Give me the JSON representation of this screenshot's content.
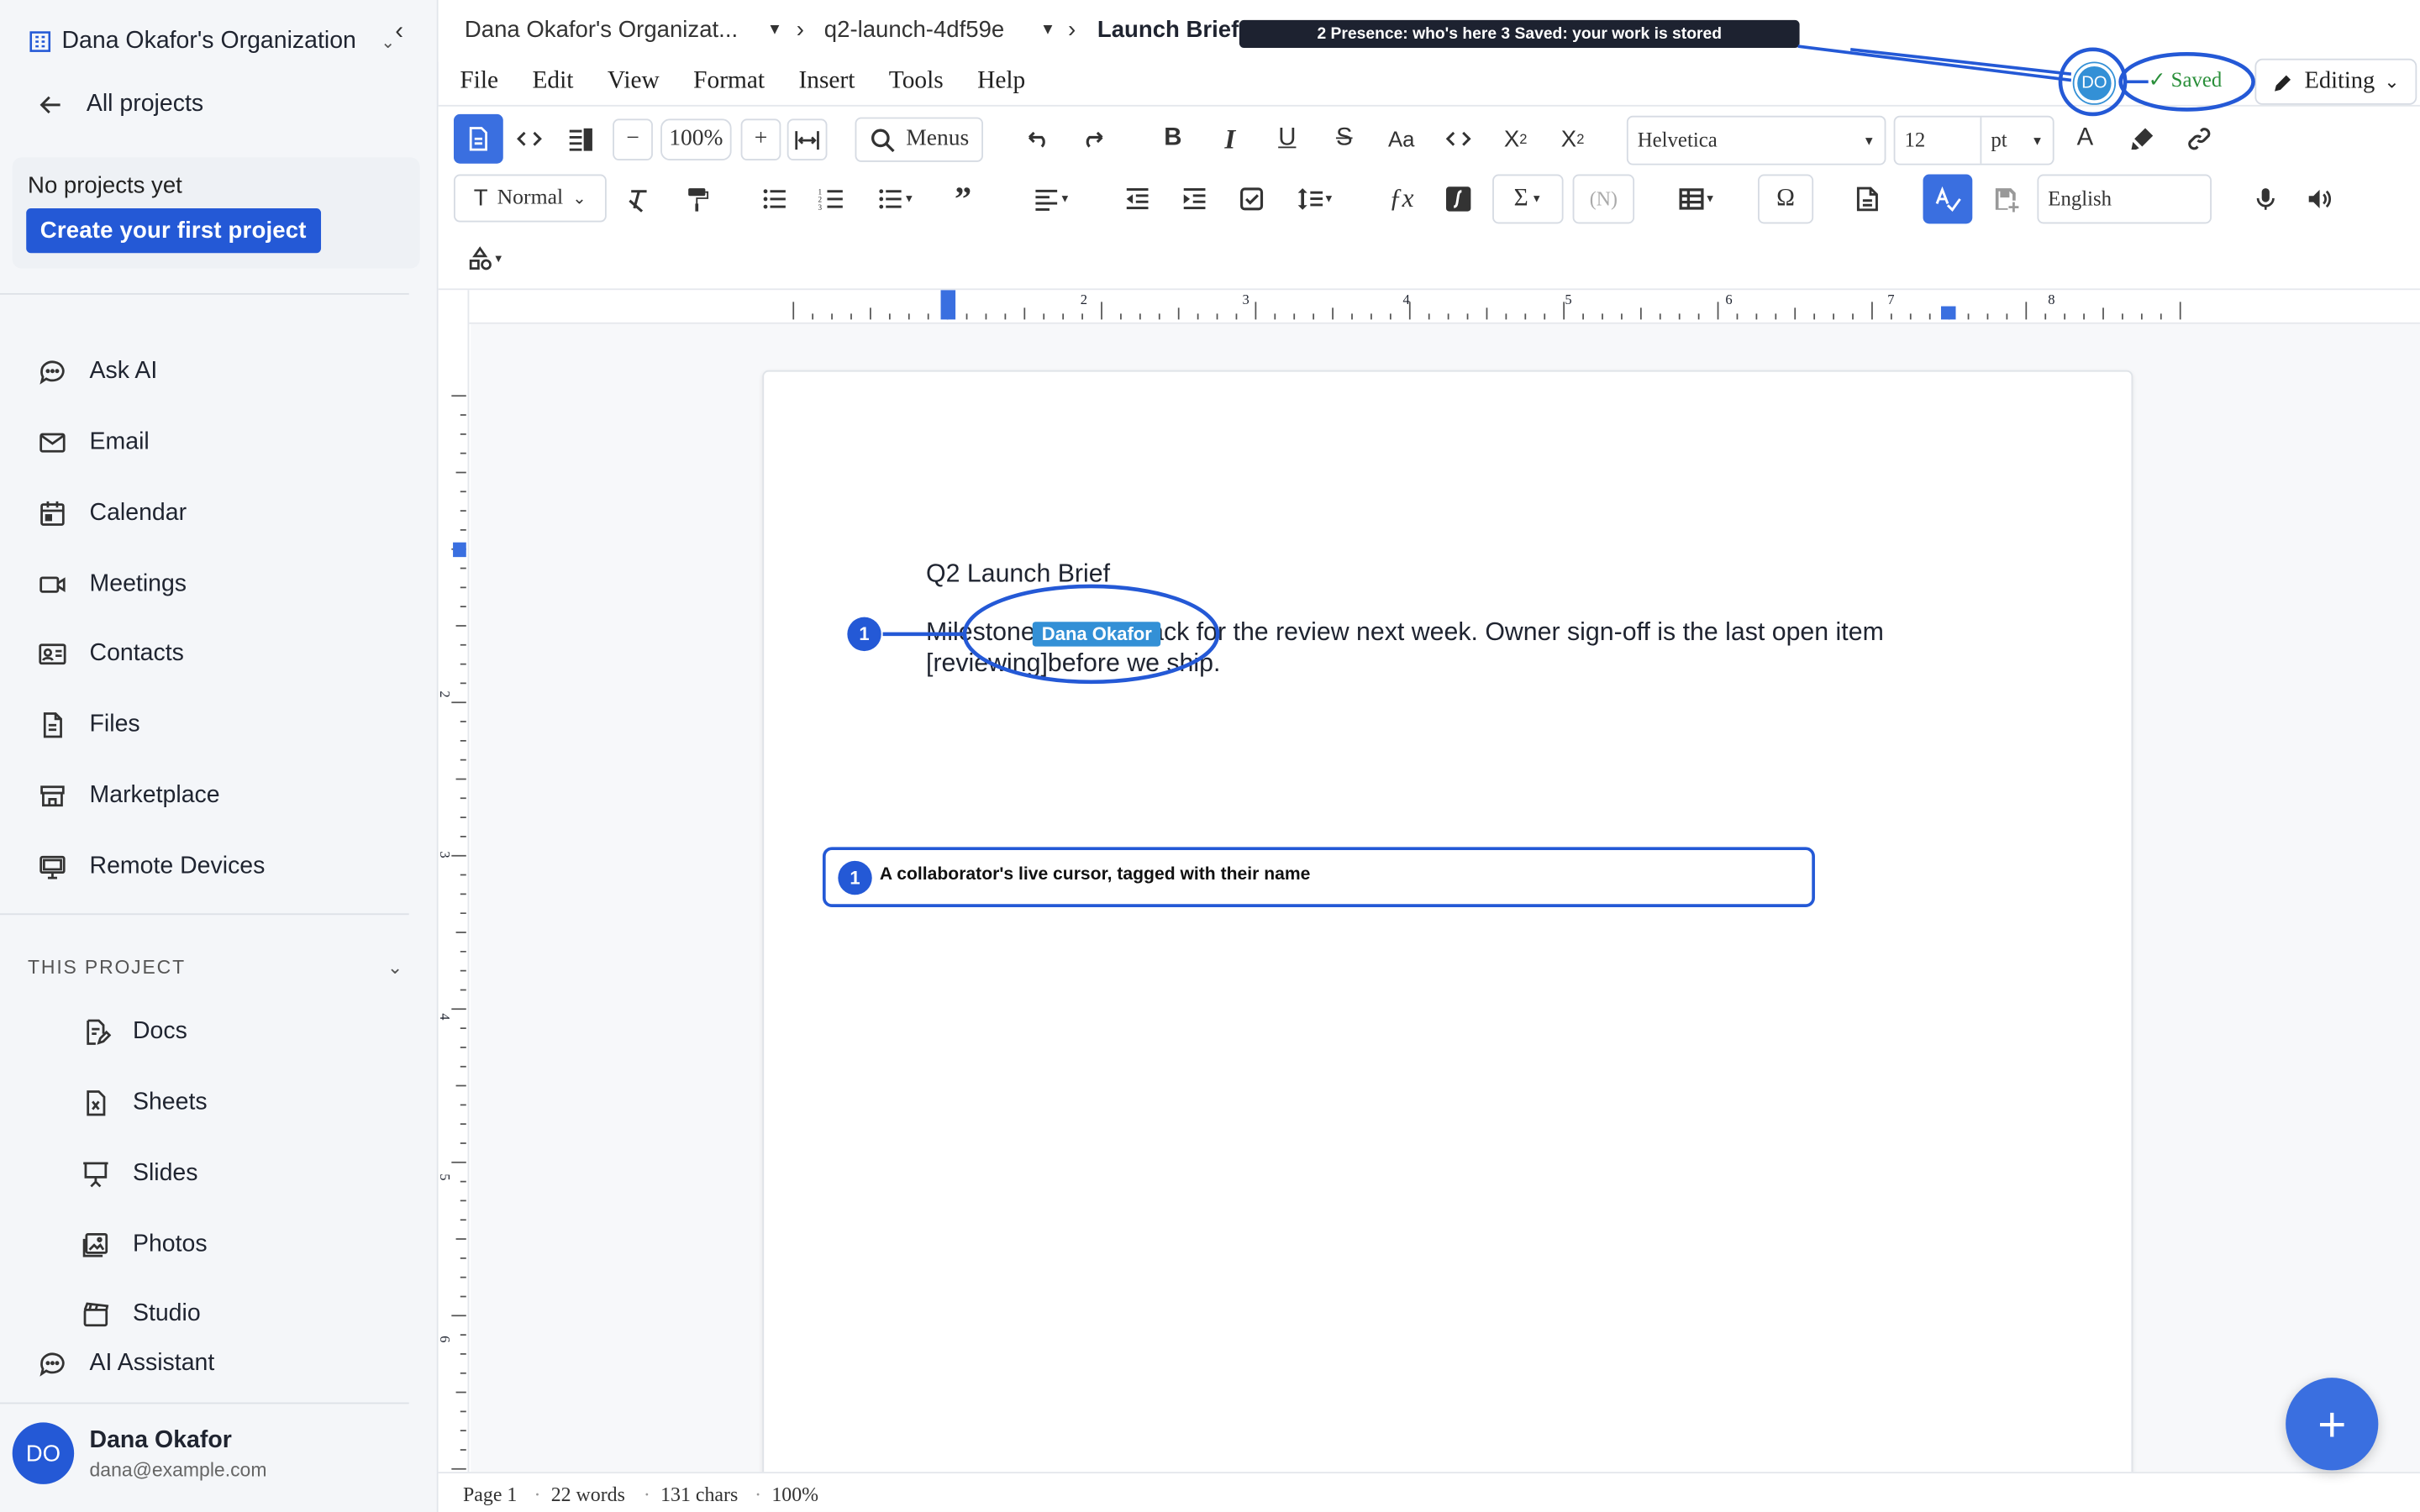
{
  "sidebar": {
    "org_name": "Dana Okafor's Organization",
    "back_label": "All projects",
    "empty_title": "No projects yet",
    "create_button": "Create your first project",
    "nav": [
      "Ask AI",
      "Email",
      "Calendar",
      "Meetings",
      "Contacts",
      "Files",
      "Marketplace",
      "Remote Devices"
    ],
    "section_title": "THIS PROJECT",
    "project_items": [
      "Docs",
      "Sheets",
      "Slides",
      "Photos",
      "Studio"
    ],
    "assistant": "AI Assistant",
    "user": {
      "initials": "DO",
      "name": "Dana Okafor",
      "email": "dana@example.com"
    }
  },
  "breadcrumb": {
    "org": "Dana Okafor's Organizat...",
    "project": "q2-launch-4df59e",
    "doc": "Launch Brief"
  },
  "tooltip": "2 Presence: who's here 3 Saved: your work is stored",
  "presence_initials": "DO",
  "saved_label": "Saved",
  "editing_label": "Editing",
  "menus": [
    "File",
    "Edit",
    "View",
    "Format",
    "Insert",
    "Tools",
    "Help"
  ],
  "toolbar": {
    "zoom": "100%",
    "menus_label": "Menus",
    "font": "Helvetica",
    "size": "12",
    "unit": "pt",
    "style": "Normal",
    "n_label": "(N)",
    "language": "English"
  },
  "ruler_labels": [
    "2",
    "3",
    "4",
    "5",
    "6",
    "7",
    "8"
  ],
  "ruler_v_labels": [
    "2",
    "3",
    "4",
    "5",
    "6"
  ],
  "doc": {
    "title": "Q2 Launch Brief",
    "body": "Milestones are on track for the review next week. Owner sign-off is the last open item [reviewing]before we ship.",
    "cursor_name": "Dana Okafor"
  },
  "callout": {
    "number": "1",
    "text": "A collaborator's live cursor, tagged with their name"
  },
  "status": {
    "page": "Page 1",
    "words": "22 words",
    "chars": "131 chars",
    "zoom": "100%"
  },
  "colors": {
    "accent": "#2459d6",
    "active": "#3a6fe0",
    "presence": "#3390d6",
    "saved": "#2a8f3a"
  }
}
